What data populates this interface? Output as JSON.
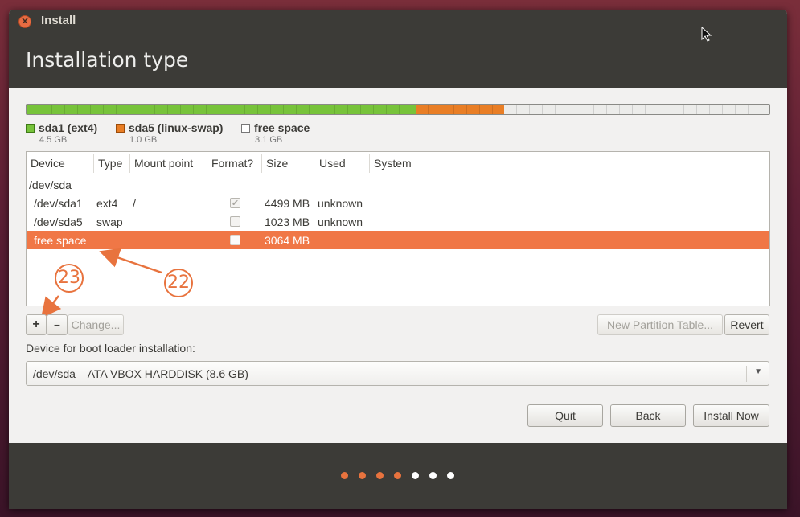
{
  "window": {
    "title": "Install",
    "close_icon": "close-icon"
  },
  "page": {
    "title": "Installation type"
  },
  "partition_bar": {
    "segments": [
      {
        "name": "sda1 (ext4)",
        "size": "4.5 GB",
        "color": "#77c33a"
      },
      {
        "name": "sda5 (linux-swap)",
        "size": "1.0 GB",
        "color": "#e97e25"
      },
      {
        "name": "free space",
        "size": "3.1 GB",
        "color": "#ececea"
      }
    ]
  },
  "table": {
    "columns": [
      "Device",
      "Type",
      "Mount point",
      "Format?",
      "Size",
      "Used",
      "System"
    ],
    "rows": [
      {
        "device": "/dev/sda",
        "type": "",
        "mount": "",
        "format": null,
        "size": "",
        "used": "",
        "system": ""
      },
      {
        "device": "/dev/sda1",
        "type": "ext4",
        "mount": "/",
        "format": true,
        "size": "4499 MB",
        "used": "unknown",
        "system": ""
      },
      {
        "device": "/dev/sda5",
        "type": "swap",
        "mount": "",
        "format": false,
        "size": "1023 MB",
        "used": "unknown",
        "system": ""
      },
      {
        "device": "free space",
        "type": "",
        "mount": "",
        "format": false,
        "size": "3064 MB",
        "used": "",
        "system": "",
        "selected": true
      }
    ]
  },
  "annotations": {
    "callout_a": "22",
    "callout_b": "23",
    "color": "#e8733e"
  },
  "toolbar": {
    "add_label": "+",
    "remove_label": "−",
    "change_label": "Change...",
    "new_table_label": "New Partition Table...",
    "revert_label": "Revert"
  },
  "bootloader": {
    "label": "Device for boot loader installation:",
    "value": "/dev/sda    ATA VBOX HARDDISK (8.6 GB)"
  },
  "buttons": {
    "quit": "Quit",
    "back": "Back",
    "install": "Install Now"
  },
  "progress": {
    "total_steps": 7,
    "completed_steps": 4,
    "active_color": "#e8733e",
    "inactive_color": "#ffffff"
  },
  "colors": {
    "accent": "#f07746",
    "chrome": "#3c3b37"
  }
}
